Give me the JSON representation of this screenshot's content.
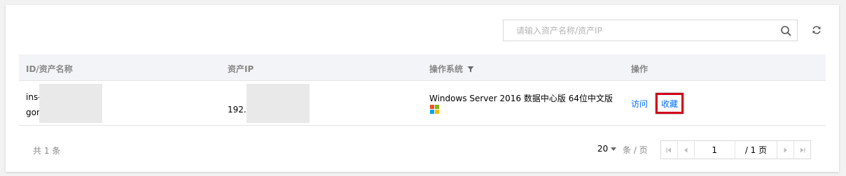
{
  "search": {
    "placeholder": "请输入资产名称/资产IP"
  },
  "table": {
    "headers": [
      "ID/资产名称",
      "资产IP",
      "操作系统",
      "操作"
    ],
    "rows": [
      {
        "id_line1": "ins-",
        "id_line2": "gon",
        "ip": "192.1",
        "os": "Windows Server 2016 数据中心版 64位中文版",
        "actions": [
          "访问",
          "收藏"
        ]
      }
    ]
  },
  "footer": {
    "total": "共 1 条",
    "page_size": "20",
    "per_page_label": "条 / 页",
    "current_page": "1",
    "total_pages": "/ 1 页"
  },
  "colors": {
    "link": "#006eff",
    "highlight": "#d0021b",
    "header_bg": "#f3f4f7"
  }
}
